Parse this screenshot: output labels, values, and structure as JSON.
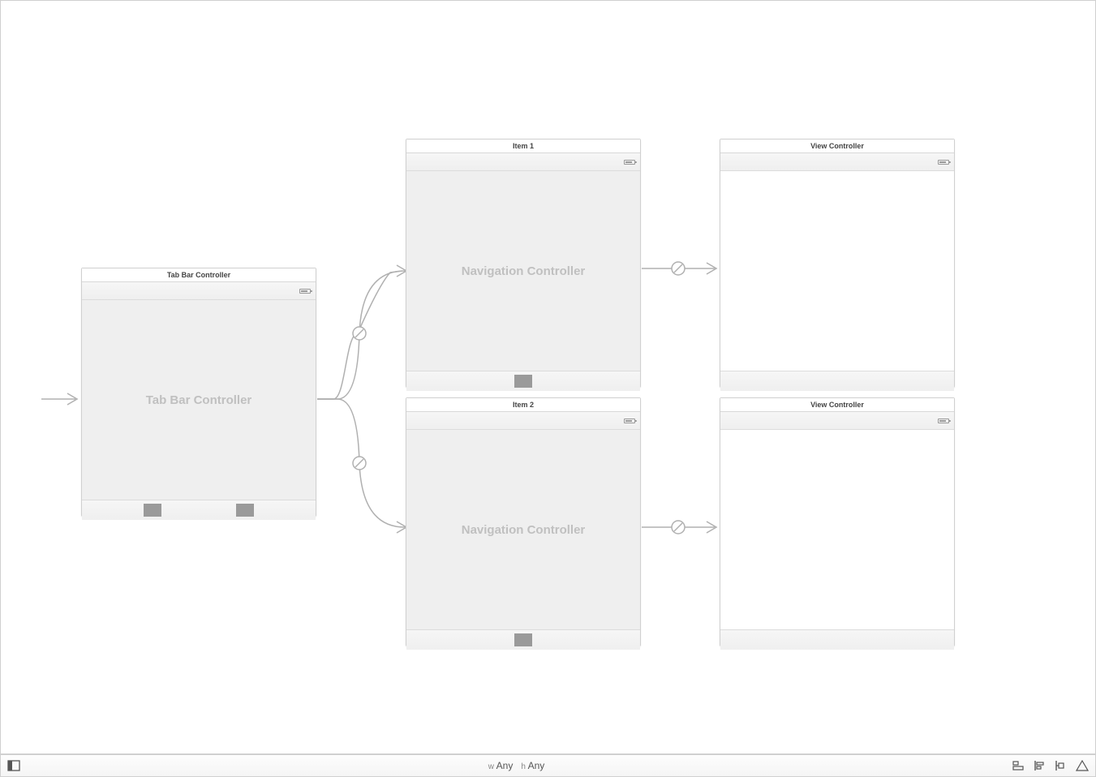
{
  "scenes": {
    "tabbar": {
      "title": "Tab Bar Controller",
      "label": "Tab Bar Controller"
    },
    "nav1": {
      "title": "Item 1",
      "label": "Navigation Controller"
    },
    "nav2": {
      "title": "Item 2",
      "label": "Navigation Controller"
    },
    "vc1": {
      "title": "View Controller"
    },
    "vc2": {
      "title": "View Controller"
    }
  },
  "bottombar": {
    "size_w_prefix": "w",
    "size_w": "Any",
    "size_h_prefix": "h",
    "size_h": "Any"
  }
}
